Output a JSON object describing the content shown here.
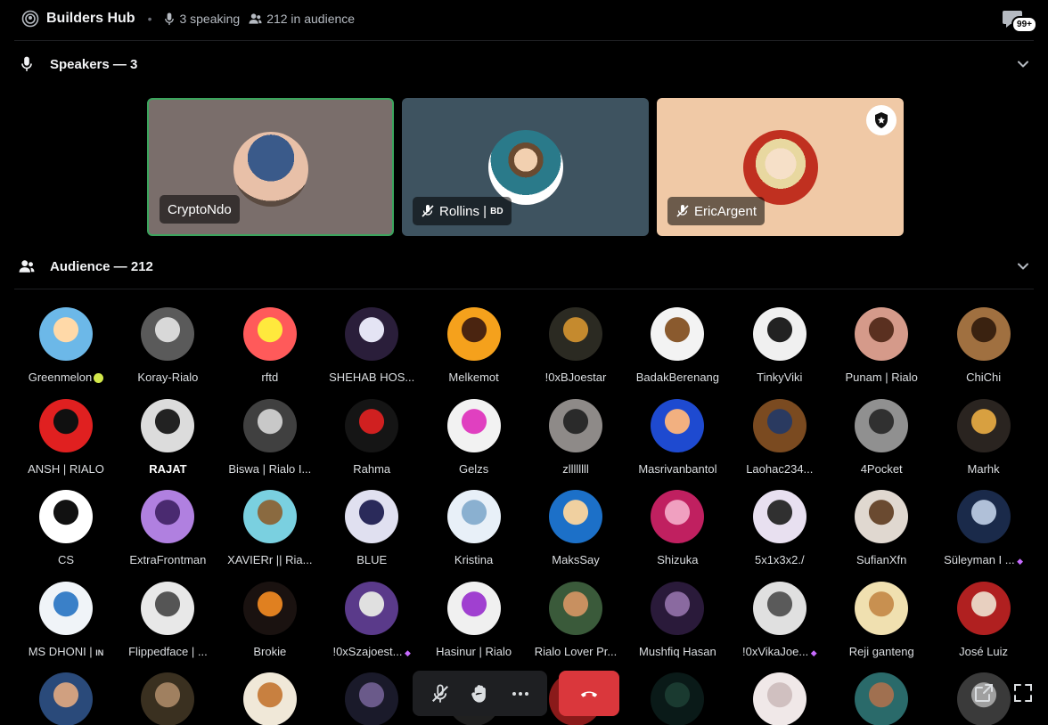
{
  "header": {
    "title": "Builders Hub",
    "speaking": "3 speaking",
    "audience": "212 in audience",
    "badge": "99+"
  },
  "speakers_section": {
    "title": "Speakers — 3"
  },
  "speakers": [
    {
      "name": "CryptoNdo",
      "tag": "",
      "muted": false,
      "active": true,
      "bg": "#7a6e6b"
    },
    {
      "name": "Rollins | ",
      "tag": "BD",
      "muted": true,
      "active": false,
      "bg": "#3e5360"
    },
    {
      "name": "EricArgent",
      "tag": "",
      "muted": true,
      "active": false,
      "bg": "#f0c9a6",
      "moderator": true
    }
  ],
  "audience_section": {
    "title": "Audience — 212"
  },
  "audience": [
    {
      "name": "Greenmelon",
      "c1": "#6cb8e8",
      "c2": "#ffd9a8",
      "extra": "lemon"
    },
    {
      "name": "Koray-Rialo",
      "c1": "#5a5a5a",
      "c2": "#d8d8d8"
    },
    {
      "name": "rftd",
      "c1": "#ff5a5a",
      "c2": "#ffe93d"
    },
    {
      "name": "SHEHAB HOS...",
      "c1": "#2a1e3a",
      "c2": "#e4e4f4"
    },
    {
      "name": "Melkemot",
      "c1": "#f5a11c",
      "c2": "#4a2410"
    },
    {
      "name": "!0xBJoestar",
      "c1": "#2b2a22",
      "c2": "#c58a2e"
    },
    {
      "name": "BadakBerenang",
      "c1": "#f3f3f3",
      "c2": "#8a5a2e"
    },
    {
      "name": "TinkyViki",
      "c1": "#f0f0f0",
      "c2": "#222222"
    },
    {
      "name": "Punam | Rialo",
      "c1": "#d59a8a",
      "c2": "#5a3020"
    },
    {
      "name": "ChiChi",
      "c1": "#a07040",
      "c2": "#3a2210"
    },
    {
      "name": "ANSH | RIALO",
      "c1": "#e02020",
      "c2": "#101010"
    },
    {
      "name": "RAJAT",
      "c1": "#dcdcdc",
      "c2": "#222222",
      "bold": true
    },
    {
      "name": "Biswa | Rialo I...",
      "c1": "#404040",
      "c2": "#c8c8c8"
    },
    {
      "name": "Rahma",
      "c1": "#151515",
      "c2": "#d02020"
    },
    {
      "name": "Gelzs",
      "c1": "#f2f2f2",
      "c2": "#e040c0"
    },
    {
      "name": "zllllllll",
      "c1": "#8e8a88",
      "c2": "#2a2a2a"
    },
    {
      "name": "Masrivanbantol",
      "c1": "#1e4ad0",
      "c2": "#f2b080"
    },
    {
      "name": "Laohac234...",
      "c1": "#7a4a20",
      "c2": "#2a3a60"
    },
    {
      "name": "4Pocket",
      "c1": "#909090",
      "c2": "#303030"
    },
    {
      "name": "Marhk",
      "c1": "#2a2420",
      "c2": "#d8a040"
    },
    {
      "name": "CS",
      "c1": "#ffffff",
      "c2": "#111111"
    },
    {
      "name": "ExtraFrontman",
      "c1": "#b080e0",
      "c2": "#4a2a70"
    },
    {
      "name": "XAVIERr || Ria...",
      "c1": "#7ad0e0",
      "c2": "#8a6a40"
    },
    {
      "name": "BLUE",
      "c1": "#e0e0f0",
      "c2": "#2a2a5a"
    },
    {
      "name": "Kristina",
      "c1": "#e8f0f8",
      "c2": "#8ab0d0"
    },
    {
      "name": "MaksSay",
      "c1": "#1c70c8",
      "c2": "#f0d0a0"
    },
    {
      "name": "Shizuka",
      "c1": "#c02060",
      "c2": "#f0a0c0"
    },
    {
      "name": "5x1x3x2./",
      "c1": "#e8e0f0",
      "c2": "#303030"
    },
    {
      "name": "SufianXfn",
      "c1": "#e0d8d0",
      "c2": "#6a4a30"
    },
    {
      "name": "Süleyman I ...",
      "c1": "#1a2a4a",
      "c2": "#b0c0d8",
      "extra": "boost"
    },
    {
      "name": "MS DHONI | ",
      "c1": "#f0f4f8",
      "c2": "#3a80c8",
      "tag": "IN"
    },
    {
      "name": "Flippedface | ...",
      "c1": "#e8e8e8",
      "c2": "#555555"
    },
    {
      "name": "Brokie",
      "c1": "#1a1210",
      "c2": "#e08020"
    },
    {
      "name": "!0xSzajoest...",
      "c1": "#5a3a8a",
      "c2": "#e0e0e0",
      "extra": "boost"
    },
    {
      "name": "Hasinur | Rialo",
      "c1": "#f0f0f0",
      "c2": "#a040d0"
    },
    {
      "name": "Rialo Lover Pr...",
      "c1": "#3a5a3a",
      "c2": "#c89060"
    },
    {
      "name": "Mushfiq Hasan",
      "c1": "#2a1a3a",
      "c2": "#8a6aa0"
    },
    {
      "name": "!0xVikaJoe...",
      "c1": "#e0e0e0",
      "c2": "#5a5a5a",
      "extra": "boost"
    },
    {
      "name": "Reji ganteng",
      "c1": "#f0e0b0",
      "c2": "#c89050"
    },
    {
      "name": "José Luiz",
      "c1": "#b02020",
      "c2": "#e8d0c0"
    },
    {
      "name": "",
      "c1": "#2a4a7a",
      "c2": "#d0a080"
    },
    {
      "name": "",
      "c1": "#3a3020",
      "c2": "#a08060"
    },
    {
      "name": "",
      "c1": "#f0e8d8",
      "c2": "#c88040"
    },
    {
      "name": "",
      "c1": "#1a1a2a",
      "c2": "#6a5a8a"
    },
    {
      "name": "",
      "c1": "#202020",
      "c2": "#e02020"
    },
    {
      "name": "",
      "c1": "#8a1a1a",
      "c2": "#101010"
    },
    {
      "name": "",
      "c1": "#0a1a18",
      "c2": "#1a3a30"
    },
    {
      "name": "",
      "c1": "#f0e8e8",
      "c2": "#d0c0c0"
    },
    {
      "name": "",
      "c1": "#2a6a6a",
      "c2": "#a07050"
    },
    {
      "name": "",
      "c1": "#3a3a3a",
      "c2": "#a0a0a0"
    }
  ],
  "controls": {
    "mute_icon": "mic-muted-icon",
    "hand_icon": "raise-hand-icon",
    "more_icon": "more-icon",
    "leave_icon": "phone-hangup-icon"
  }
}
